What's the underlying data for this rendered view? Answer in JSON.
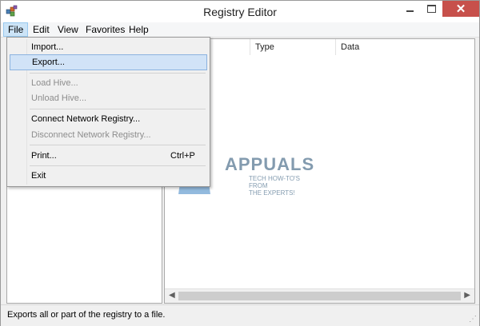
{
  "window": {
    "title": "Registry Editor",
    "close_glyph": "✕"
  },
  "menubar": {
    "items": [
      {
        "label": "File",
        "active": true
      },
      {
        "label": "Edit"
      },
      {
        "label": "View"
      },
      {
        "label": "Favorites"
      },
      {
        "label": "Help"
      }
    ]
  },
  "file_menu": {
    "items": [
      {
        "label": "Import...",
        "enabled": true
      },
      {
        "label": "Export...",
        "enabled": true,
        "highlighted": true
      },
      {
        "label": "Load Hive...",
        "enabled": false
      },
      {
        "label": "Unload Hive...",
        "enabled": false
      },
      {
        "label": "Connect Network Registry...",
        "enabled": true
      },
      {
        "label": "Disconnect Network Registry...",
        "enabled": false
      },
      {
        "label": "Print...",
        "shortcut": "Ctrl+P",
        "enabled": true
      },
      {
        "label": "Exit",
        "enabled": true
      }
    ]
  },
  "list_view": {
    "columns": [
      {
        "label": "Type"
      },
      {
        "label": "Data"
      }
    ]
  },
  "status_bar": {
    "text": "Exports all or part of the registry to a file."
  },
  "watermark": {
    "brand": "APPUALS",
    "tagline_1": "TECH HOW-TO'S FROM",
    "tagline_2": "THE EXPERTS!"
  },
  "icons": {
    "app": "registry-cubes-icon",
    "minimize": "minimize-icon",
    "maximize": "maximize-icon",
    "close": "close-icon",
    "scroll_left": "scroll-left-arrow-icon",
    "scroll_right": "scroll-right-arrow-icon"
  },
  "colors": {
    "menu_highlight": "#d1e3f7",
    "close_button": "#c7504b",
    "disabled_text": "#8d8d8d"
  }
}
